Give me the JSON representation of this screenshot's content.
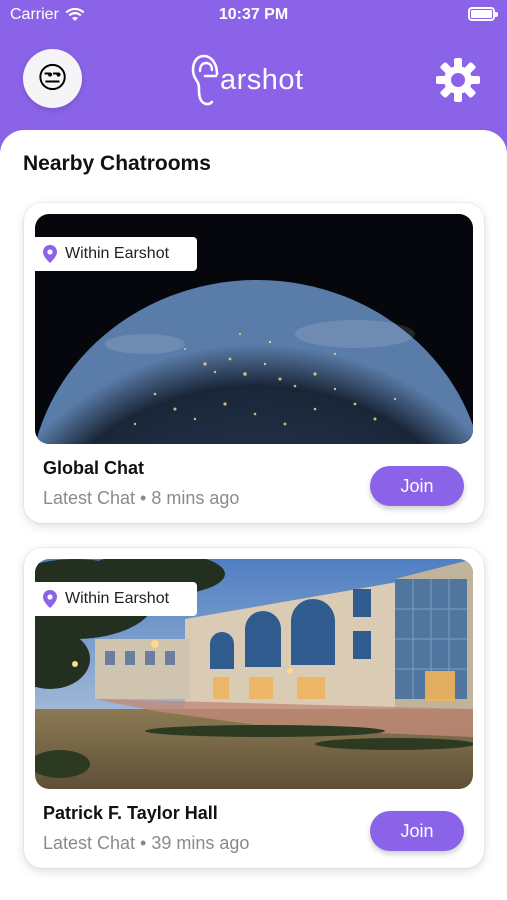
{
  "status_bar": {
    "carrier": "Carrier",
    "time": "10:37 PM"
  },
  "header": {
    "logo_text": "arshot",
    "avatar_emoji": "😒",
    "settings_icon": "gear-icon"
  },
  "section": {
    "title": "Nearby Chatrooms"
  },
  "chatrooms": [
    {
      "badge": "Within Earshot",
      "name": "Global Chat",
      "latest": "Latest Chat • 8 mins ago",
      "join_label": "Join",
      "image": "earth-at-night"
    },
    {
      "badge": "Within Earshot",
      "name": "Patrick F. Taylor Hall",
      "latest": "Latest Chat • 39 mins ago",
      "join_label": "Join",
      "image": "campus-building"
    }
  ],
  "colors": {
    "accent": "#8a63e8",
    "text_primary": "#111111",
    "text_secondary": "#8a8a8a"
  }
}
